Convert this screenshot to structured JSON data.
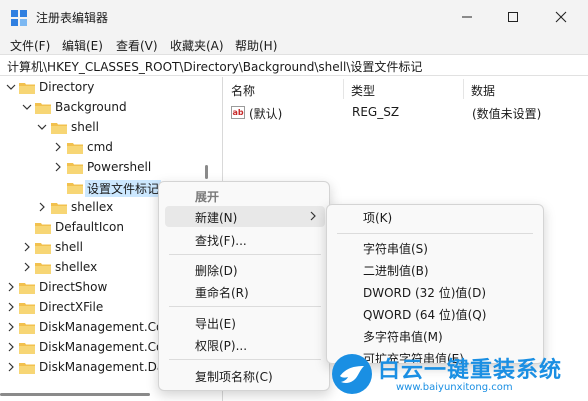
{
  "window": {
    "title": "注册表编辑器",
    "min_glyph": "—",
    "max_glyph": "☐",
    "close_glyph": "✕"
  },
  "menubar": [
    "文件(F)",
    "编辑(E)",
    "查看(V)",
    "收藏夹(A)",
    "帮助(H)"
  ],
  "address": "计算机\\HKEY_CLASSES_ROOT\\Directory\\Background\\shell\\设置文件标记",
  "tree": [
    {
      "label": "Directory",
      "expanded": true
    },
    {
      "label": "Background",
      "expanded": true
    },
    {
      "label": "shell",
      "expanded": true
    },
    {
      "label": "cmd",
      "expanded": false
    },
    {
      "label": "Powershell",
      "expanded": false
    },
    {
      "label": "设置文件标记",
      "selected": true
    },
    {
      "label": "shellex",
      "expanded": false
    },
    {
      "label": "DefaultIcon"
    },
    {
      "label": "shell",
      "expanded": false
    },
    {
      "label": "shellex",
      "expanded": false
    },
    {
      "label": "DirectShow",
      "expanded": false
    },
    {
      "label": "DirectXFile",
      "expanded": false
    },
    {
      "label": "DiskManagement.Co",
      "expanded": false
    },
    {
      "label": "DiskManagement.Co",
      "expanded": false
    },
    {
      "label": "DiskManagement.Da",
      "expanded": false
    }
  ],
  "list": {
    "columns": [
      "名称",
      "类型",
      "数据"
    ],
    "rows": [
      {
        "icon": "ab",
        "name": "(默认)",
        "type": "REG_SZ",
        "data": "(数值未设置)"
      }
    ]
  },
  "context_menu": {
    "items": [
      "展开",
      "新建(N)",
      "查找(F)...",
      "删除(D)",
      "重命名(R)",
      "导出(E)",
      "权限(P)...",
      "复制项名称(C)"
    ]
  },
  "submenu": {
    "items": [
      "项(K)",
      "字符串值(S)",
      "二进制值(B)",
      "DWORD (32 位)值(D)",
      "QWORD (64 位)值(Q)",
      "多字符串值(M)",
      "可扩充字符串值(E)"
    ]
  },
  "watermark": {
    "title": "白云一键重装系统",
    "url": "www.baiyunxitong.com"
  },
  "colors": {
    "accent": "#1a8fe3",
    "folder": "#f2c14e",
    "selection": "#cce8ff"
  }
}
